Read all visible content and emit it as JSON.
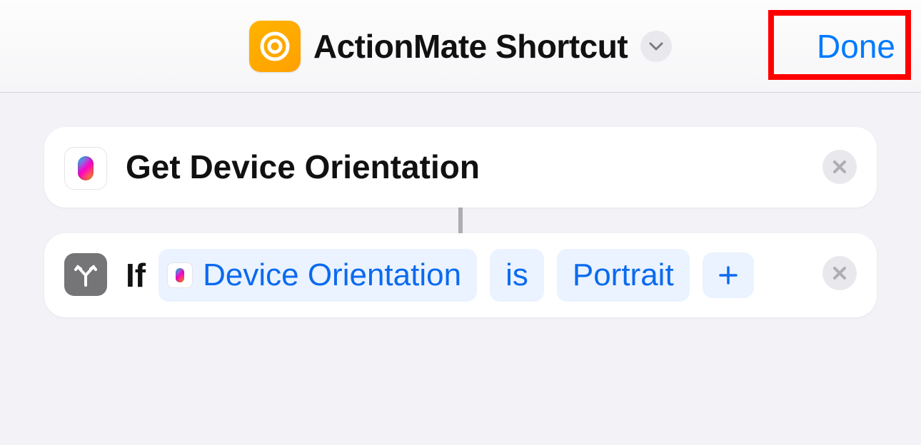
{
  "header": {
    "title": "ActionMate Shortcut",
    "done_label": "Done",
    "colors": {
      "accent": "#007aff",
      "app_icon_bg": "#ffb300"
    }
  },
  "actions": [
    {
      "icon": "actions-pill-icon",
      "title": "Get Device Orientation"
    },
    {
      "icon": "branch-icon",
      "keyword": "If",
      "variable": "Device Orientation",
      "condition": "is",
      "value": "Portrait"
    }
  ]
}
